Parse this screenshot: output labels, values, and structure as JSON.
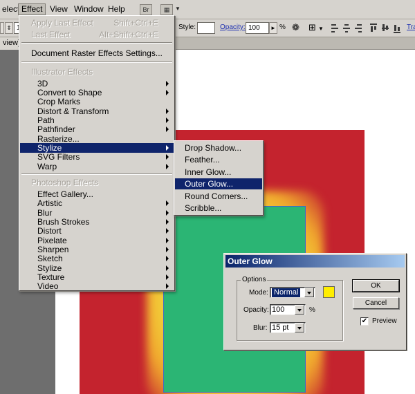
{
  "menubar": {
    "items": [
      "elect",
      "Effect",
      "View",
      "Window",
      "Help"
    ],
    "bridge_label": "Br"
  },
  "controlbar": {
    "stroke_value": "1",
    "style_label": "Style:",
    "opacity_label": "Opacity:",
    "opacity_value": "100",
    "opacity_unit": "%",
    "transform_label": "Tra"
  },
  "document_tab": {
    "label": "view)"
  },
  "effect_menu": {
    "apply_last_label": "Apply Last Effect",
    "apply_last_shortcut": "Shift+Ctrl+E",
    "last_effect_label": "Last Effect",
    "last_effect_shortcut": "Alt+Shift+Ctrl+E",
    "document_raster_label": "Document Raster Effects Settings...",
    "illustrator_header": "Illustrator Effects",
    "illustrator_items": [
      {
        "label": "3D",
        "submenu": true
      },
      {
        "label": "Convert to Shape",
        "submenu": true
      },
      {
        "label": "Crop Marks",
        "submenu": false
      },
      {
        "label": "Distort & Transform",
        "submenu": true
      },
      {
        "label": "Path",
        "submenu": true
      },
      {
        "label": "Pathfinder",
        "submenu": true
      },
      {
        "label": "Rasterize...",
        "submenu": false
      },
      {
        "label": "Stylize",
        "submenu": true
      },
      {
        "label": "SVG Filters",
        "submenu": true
      },
      {
        "label": "Warp",
        "submenu": true
      }
    ],
    "photoshop_header": "Photoshop Effects",
    "photoshop_items": [
      {
        "label": "Effect Gallery...",
        "submenu": false
      },
      {
        "label": "Artistic",
        "submenu": true
      },
      {
        "label": "Blur",
        "submenu": true
      },
      {
        "label": "Brush Strokes",
        "submenu": true
      },
      {
        "label": "Distort",
        "submenu": true
      },
      {
        "label": "Pixelate",
        "submenu": true
      },
      {
        "label": "Sharpen",
        "submenu": true
      },
      {
        "label": "Sketch",
        "submenu": true
      },
      {
        "label": "Stylize",
        "submenu": true
      },
      {
        "label": "Texture",
        "submenu": true
      },
      {
        "label": "Video",
        "submenu": true
      }
    ],
    "selected_item": "Stylize"
  },
  "stylize_menu": {
    "items": [
      "Drop Shadow...",
      "Feather...",
      "Inner Glow...",
      "Outer Glow...",
      "Round Corners...",
      "Scribble..."
    ],
    "selected_item": "Outer Glow..."
  },
  "outer_glow_dialog": {
    "title": "Outer Glow",
    "options_legend": "Options",
    "mode_label": "Mode:",
    "mode_value": "Normal",
    "glow_color": "#ffee00",
    "opacity_label": "Opacity:",
    "opacity_value": "100",
    "opacity_unit": "%",
    "blur_label": "Blur:",
    "blur_value": "15 pt",
    "ok_label": "OK",
    "cancel_label": "Cancel",
    "preview_label": "Preview",
    "preview_checked": true
  },
  "colors": {
    "menu_highlight": "#0f246b",
    "title_bar_start": "#0a246a",
    "red_shape": "#c4232e",
    "green_shape": "#2bb574"
  }
}
